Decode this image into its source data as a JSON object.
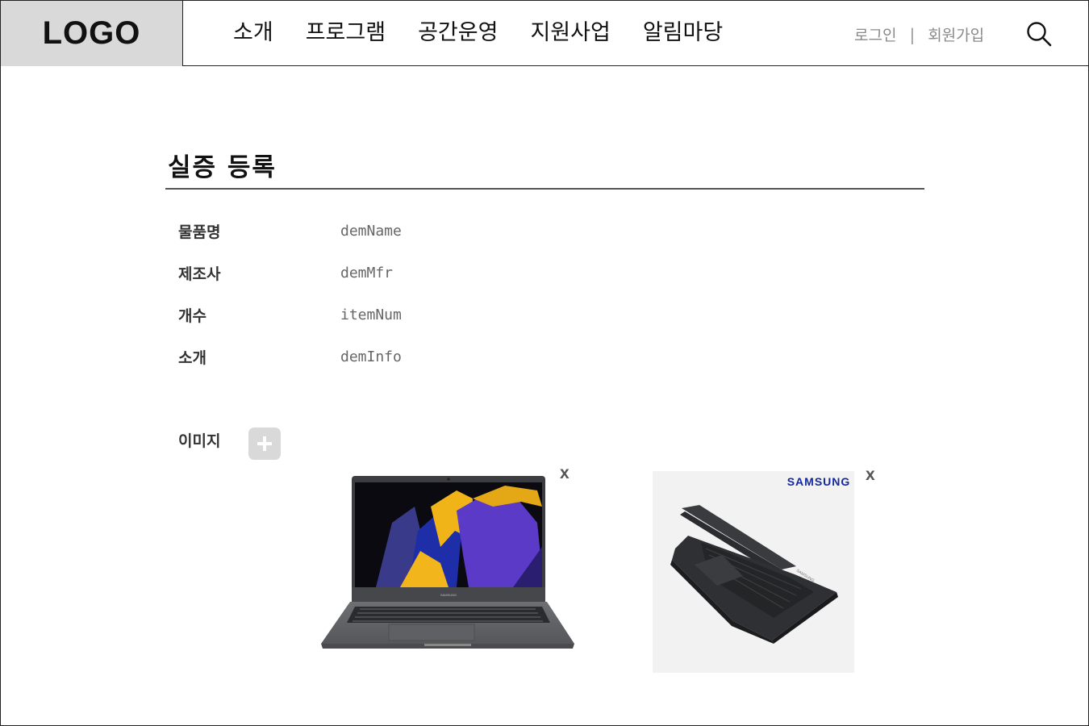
{
  "header": {
    "logo": "LOGO",
    "nav": [
      "소개",
      "프로그램",
      "공간운영",
      "지원사업",
      "알림마당"
    ],
    "login": "로그인",
    "separator": "|",
    "signup": "회원가입",
    "search_icon": "search-icon"
  },
  "main": {
    "title": "실증  등록",
    "fields": [
      {
        "label": "물품명",
        "value": "demName"
      },
      {
        "label": "제조사",
        "value": "demMfr"
      },
      {
        "label": "개수",
        "value": "itemNum"
      },
      {
        "label": "소개",
        "value": "demInfo"
      }
    ],
    "image_label": "이미지",
    "add_icon": "plus-icon",
    "images": [
      {
        "alt": "laptop-open-front",
        "remove_label": "x"
      },
      {
        "alt": "laptop-angled-dark",
        "brand": "SAMSUNG",
        "remove_label": "x"
      }
    ]
  },
  "colors": {
    "logo_bg": "#d9d9d9",
    "text": "#111111",
    "muted": "#8a8a8a",
    "value_text": "#666666",
    "add_button": "#d9d9d9",
    "samsung_blue": "#1428a0"
  }
}
